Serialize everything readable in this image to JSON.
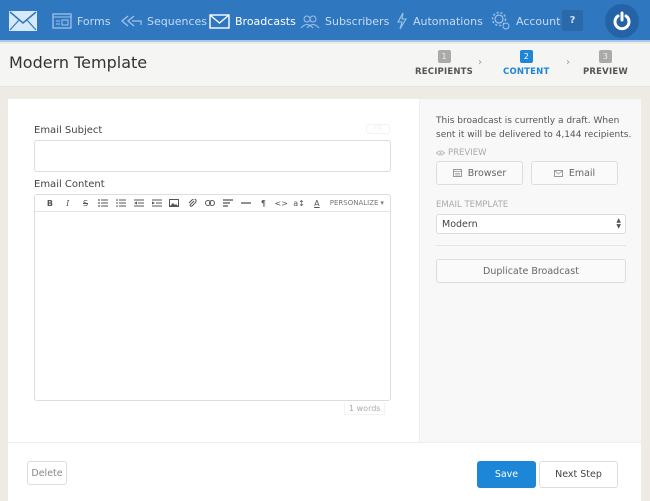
{
  "nav": {
    "items": [
      {
        "label": "Forms",
        "icon": "form-icon"
      },
      {
        "label": "Sequences",
        "icon": "sequence-icon"
      },
      {
        "label": "Broadcasts",
        "icon": "envelope-icon",
        "active": true
      },
      {
        "label": "Subscribers",
        "icon": "users-icon"
      },
      {
        "label": "Automations",
        "icon": "lightning-icon"
      },
      {
        "label": "Account",
        "icon": "gear-icon"
      }
    ],
    "help_label": "?"
  },
  "header": {
    "title": "Modern Template",
    "steps": [
      {
        "num": "1",
        "label": "RECIPIENTS"
      },
      {
        "num": "2",
        "label": "CONTENT",
        "active": true
      },
      {
        "num": "3",
        "label": "PREVIEW"
      }
    ],
    "step_separator": "›"
  },
  "editor": {
    "subject_label": "Email Subject",
    "subject_value": "",
    "fill_label": "Fill",
    "content_label": "Email Content",
    "toolbar": {
      "bold": "B",
      "italic": "I",
      "strike": "S",
      "personalize": "PERSONALIZE"
    },
    "word_count": "1 words"
  },
  "sidebar": {
    "draft_message": "This broadcast is currently a draft. When sent it will be delivered to 4,144 recipients.",
    "preview_label": "PREVIEW",
    "browser_label": "Browser",
    "email_label": "Email",
    "template_label": "EMAIL TEMPLATE",
    "template_value": "Modern",
    "duplicate_label": "Duplicate Broadcast"
  },
  "footer": {
    "delete_label": "Delete",
    "save_label": "Save",
    "next_label": "Next Step"
  },
  "colors": {
    "nav_bg": "#2f78c0",
    "accent": "#1d86d6",
    "page_bg": "#eeebe5"
  }
}
